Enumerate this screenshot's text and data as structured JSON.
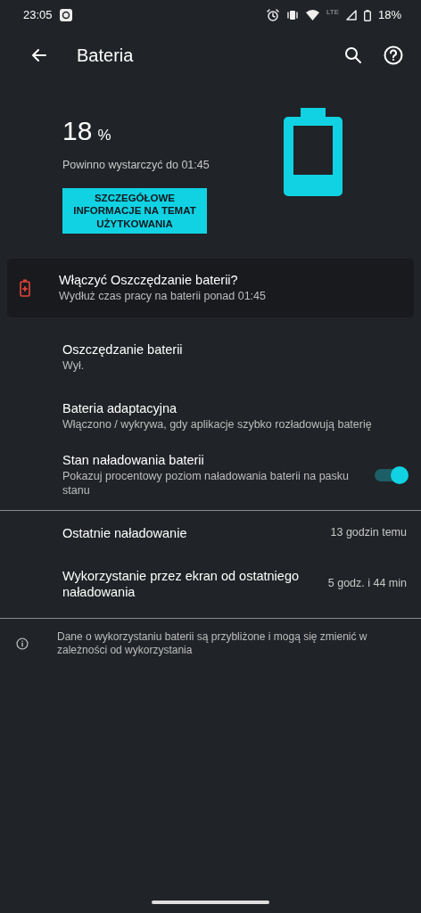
{
  "status_bar": {
    "time": "23:05",
    "network": "LTE",
    "battery": "18%"
  },
  "toolbar": {
    "title": "Bateria"
  },
  "summary": {
    "percent": "18",
    "unit": "%",
    "estimate": "Powinno wystarczyć do 01:45",
    "button": "SZCZEGÓŁOWE INFORMACJE NA TEMAT UŻYTKOWANIA"
  },
  "suggestion": {
    "title": "Włączyć Oszczędzanie baterii?",
    "subtitle": "Wydłuż czas pracy na baterii ponad 01:45"
  },
  "settings": [
    {
      "kind": "plain",
      "title": "Oszczędzanie baterii",
      "subtitle": "Wył."
    },
    {
      "kind": "plain",
      "title": "Bateria adaptacyjna",
      "subtitle": "Włączono / wykrywa, gdy aplikacje szybko rozładowują baterię"
    },
    {
      "kind": "switch",
      "title": "Stan naładowania baterii",
      "subtitle": "Pokazuj procentowy poziom naładowania baterii na pasku stanu",
      "on": true
    }
  ],
  "usage": [
    {
      "label": "Ostatnie naładowanie",
      "value": "13 godzin temu"
    },
    {
      "label": "Wykorzystanie przez ekran od ostatniego naładowania",
      "value": "5 godz. i 44 min"
    }
  ],
  "footer_note": "Dane o wykorzystaniu baterii są przybliżone i mogą się zmienić w zależności od wykorzystania"
}
